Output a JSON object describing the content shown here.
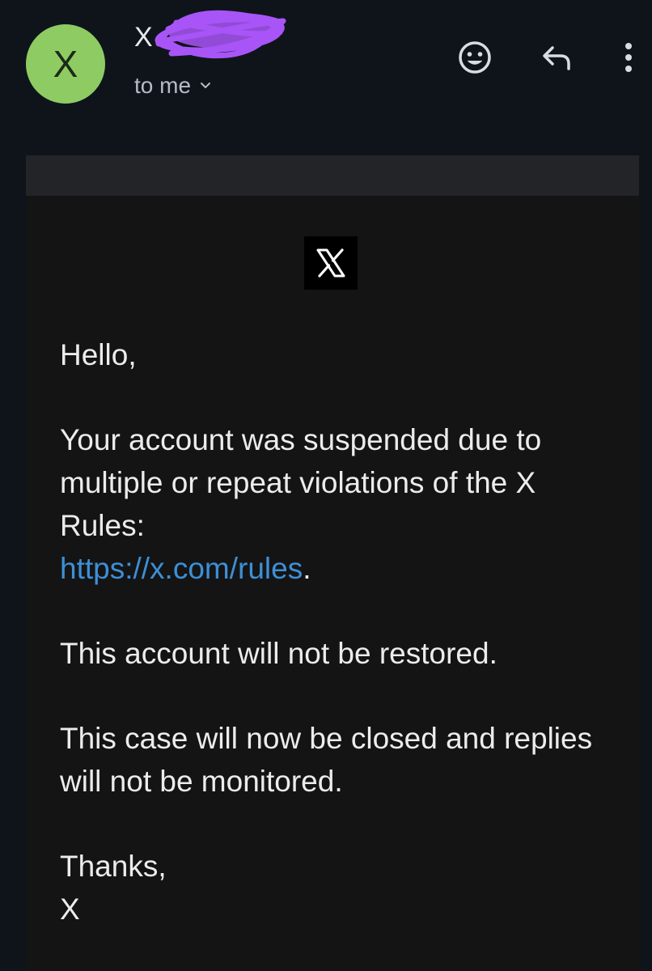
{
  "header": {
    "avatar_letter": "X",
    "avatar_color": "#8ecc63",
    "sender_name": "X",
    "recipient_label": "to me",
    "icons": [
      "smiley-icon",
      "reply-icon",
      "more-vert-icon"
    ]
  },
  "email": {
    "greeting": "Hello,",
    "para1_text": "Your account was suspended due to multiple or repeat violations of the X Rules:",
    "rules_link": "https://x.com/rules",
    "para1_end": ".",
    "para2": "This account will not be restored.",
    "para3": "This case will now be closed and replies will not be monitored.",
    "signoff": "Thanks,",
    "signature": "X"
  },
  "colors": {
    "background": "#0f141b",
    "card": "#141414",
    "link": "#3d8fd6",
    "redaction": "#a855f7"
  }
}
